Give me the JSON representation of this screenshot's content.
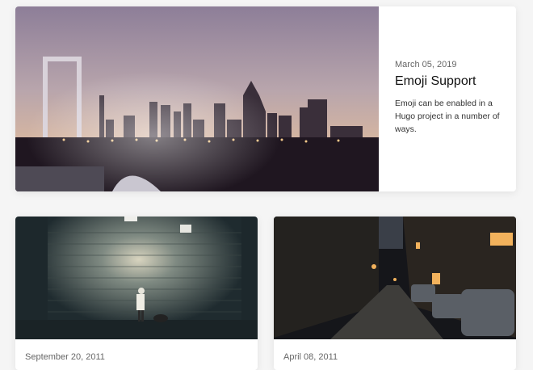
{
  "featured_post": {
    "date": "March 05, 2019",
    "title": "Emoji Support",
    "excerpt": "Emoji can be enabled in a Hugo project in a number of ways.",
    "image_icon": "city-skyline-photo"
  },
  "posts": [
    {
      "date": "September 20, 2011",
      "image_icon": "wall-lamp-night-photo"
    },
    {
      "date": "April 08, 2011",
      "image_icon": "night-street-photo"
    }
  ]
}
